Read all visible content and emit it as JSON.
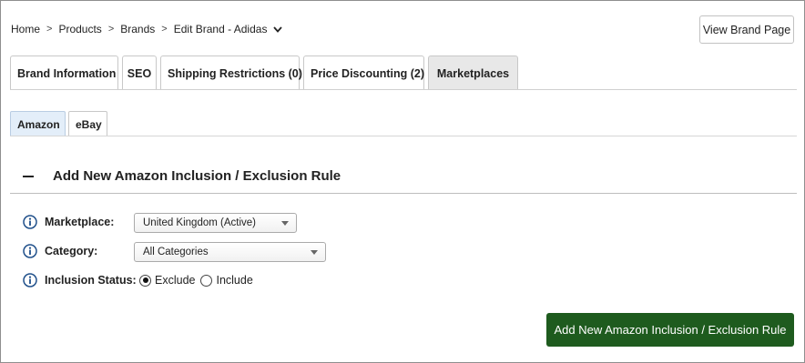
{
  "breadcrumb": {
    "items": [
      "Home",
      "Products",
      "Brands",
      "Edit Brand - Adidas"
    ],
    "separator": ">",
    "dropdown_icon": "chevron-down-icon"
  },
  "header": {
    "view_brand_label": "View Brand Page"
  },
  "main_tabs": [
    {
      "label": "Brand Information",
      "active": false
    },
    {
      "label": "SEO",
      "active": false
    },
    {
      "label": "Shipping Restrictions (0)",
      "active": false
    },
    {
      "label": "Price Discounting (2)",
      "active": false
    },
    {
      "label": "Marketplaces",
      "active": true
    }
  ],
  "sub_tabs": [
    {
      "label": "Amazon",
      "active": true
    },
    {
      "label": "eBay",
      "active": false
    }
  ],
  "section": {
    "title": "Add New Amazon Inclusion / Exclusion Rule",
    "collapse_icon": "minus-icon"
  },
  "form": {
    "marketplace": {
      "label": "Marketplace:",
      "value": "United Kingdom (Active)",
      "icon": "info-icon"
    },
    "category": {
      "label": "Category:",
      "value": "All Categories",
      "icon": "info-icon"
    },
    "inclusion_status": {
      "label": "Inclusion Status:",
      "icon": "info-icon",
      "options": [
        {
          "label": "Exclude",
          "checked": true
        },
        {
          "label": "Include",
          "checked": false
        }
      ]
    }
  },
  "submit_label": "Add New Amazon Inclusion / Exclusion Rule",
  "colors": {
    "submit_bg": "#1e5b1e",
    "info_icon": "#1f4f8a",
    "active_main_tab": "#e8e8e8",
    "active_sub_tab": "#e3eef9"
  }
}
